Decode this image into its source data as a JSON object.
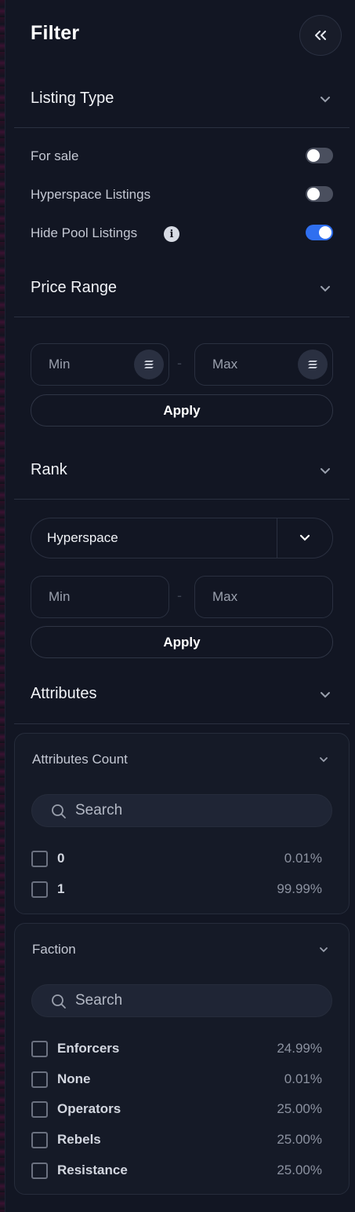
{
  "filter": {
    "title": "Filter",
    "collapse_icon": "double-chevron-left-icon",
    "sections": {
      "listing_type": {
        "title": "Listing Type",
        "options": [
          {
            "label": "For sale",
            "enabled": false
          },
          {
            "label": "Hyperspace Listings",
            "enabled": false
          },
          {
            "label": "Hide Pool Listings",
            "enabled": true
          }
        ]
      },
      "price_range": {
        "title": "Price Range",
        "min_placeholder": "Min",
        "max_placeholder": "Max",
        "separator": "-",
        "apply_label": "Apply"
      },
      "rank": {
        "title": "Rank",
        "source_selected": "Hyperspace",
        "min_placeholder": "Min",
        "max_placeholder": "Max",
        "separator": "-",
        "apply_label": "Apply"
      },
      "attributes": {
        "title": "Attributes",
        "groups": [
          {
            "title": "Attributes Count",
            "search_placeholder": "Search",
            "items": [
              {
                "label": "0",
                "percent": "0.01%"
              },
              {
                "label": "1",
                "percent": "99.99%"
              }
            ]
          },
          {
            "title": "Faction",
            "search_placeholder": "Search",
            "items": [
              {
                "label": "Enforcers",
                "percent": "24.99%"
              },
              {
                "label": "None",
                "percent": "0.01%"
              },
              {
                "label": "Operators",
                "percent": "25.00%"
              },
              {
                "label": "Rebels",
                "percent": "25.00%"
              },
              {
                "label": "Resistance",
                "percent": "25.00%"
              }
            ]
          }
        ]
      }
    }
  },
  "colors": {
    "panel_bg": "#121623",
    "accent_toggle_on": "#2f6ff0",
    "divider": "#2a3040"
  }
}
